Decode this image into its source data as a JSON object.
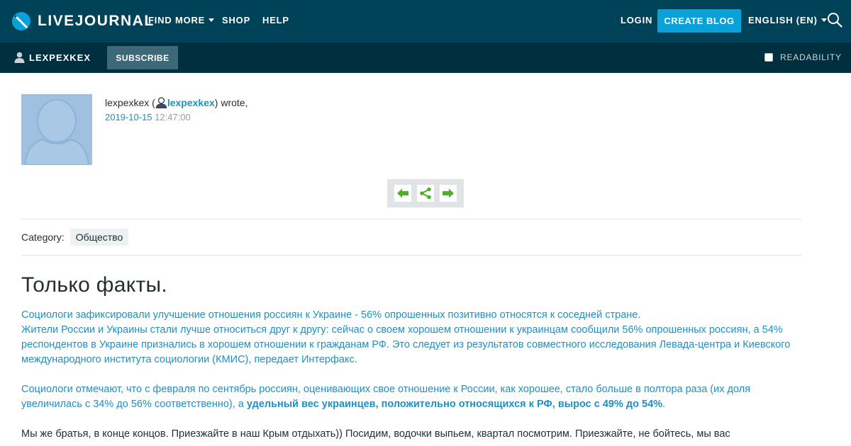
{
  "header": {
    "logo_text": "LIVEJOURNAL",
    "nav": {
      "find_more": "FIND MORE",
      "shop": "SHOP",
      "help": "HELP",
      "login": "LOGIN",
      "create_blog": "CREATE BLOG",
      "language": "ENGLISH (EN)"
    }
  },
  "journal_bar": {
    "username": "LEXPEXKEX",
    "subscribe": "SUBSCRIBE",
    "readability": "READABILITY"
  },
  "entry": {
    "author_name": "lexpexkex",
    "author_link": "lexpexkex",
    "wrote_prefix": " (",
    "wrote_suffix": ") wrote,",
    "date": "2019-10-15",
    "time": " 12:47:00",
    "category_label": "Category:",
    "category_tag": "Общество",
    "title": "Только факты.",
    "para1_line1": "Социологи зафиксировали улучшение отношения россиян к Украине - 56% опрошенных позитивно относятся к соседней стране.",
    "para1_rest": "Жители России и Украины стали лучше относиться друг к другу: сейчас о своем хорошем отношении к украинцам сообщили 56% опрошенных россиян, а 54% респондентов в Украине признались в хорошем отношении к гражданам РФ. Это следует из результатов совместного исследования Левада-центра и Киевского международного института социологии (КМИС), передает Интерфакс.",
    "para2_text": "Социологи отмечают, что с февраля по сентябрь россиян, оценивающих свое отношение к России, как хорошее, стало больше в полтора раза (их доля увеличилась с 34% до 56% соответственно), а ",
    "para2_bold": "удельный вес украинцев, положительно относящихся к РФ, вырос с 49% до 54%",
    "para2_end": ".",
    "para3": "Мы же братья, в конце концов. Приезжайте в наш Крым отдыхать)) Посидим, водочки выпьем, квартал посмотрим. Приезжайте, не бойтесь, мы вас"
  },
  "colors": {
    "topbar": "#004359",
    "journalbar": "#00303f",
    "accent": "#0aa0d8",
    "link": "#1d91c3",
    "nav_arrow": "#4fae2e"
  },
  "icons": {
    "logo": "livejournal-pencil-icon",
    "search": "search-icon",
    "user": "user-icon",
    "prev": "arrow-left-icon",
    "share": "share-icon",
    "next": "arrow-right-icon"
  }
}
